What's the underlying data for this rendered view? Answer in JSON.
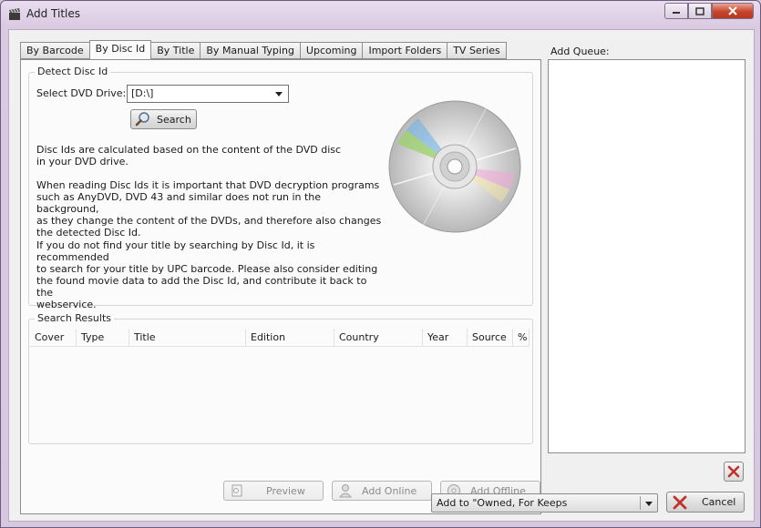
{
  "window": {
    "title": "Add Titles"
  },
  "tabs": [
    {
      "label": "By Barcode"
    },
    {
      "label": "By Disc Id"
    },
    {
      "label": "By Title"
    },
    {
      "label": "By Manual Typing"
    },
    {
      "label": "Upcoming"
    },
    {
      "label": "Import Folders"
    },
    {
      "label": "TV Series"
    }
  ],
  "detect": {
    "group_label": "Detect Disc Id",
    "drive_label": "Select DVD Drive:",
    "drive_value": "[D:\\]",
    "search_label": "Search",
    "para1": "Disc Ids are calculated based on the content of the DVD disc\nin your DVD drive.",
    "para2": "When reading Disc Ids it is important that DVD decryption programs\nsuch as AnyDVD, DVD 43 and similar does not run in the background,\nas they change the content of the DVDs, and therefore also changes\nthe detected Disc Id.",
    "para3": "If you do not find your title by searching by Disc Id, it is recommended\nto search for your title by UPC barcode. Please also consider editing\nthe found movie data to add the Disc Id, and contribute it back to the\nwebservice."
  },
  "results": {
    "group_label": "Search Results",
    "columns": [
      "Cover",
      "Type",
      "Title",
      "Edition",
      "Country",
      "Year",
      "Source",
      "%"
    ]
  },
  "actions": {
    "preview": "Preview",
    "add_online": "Add Online",
    "add_offline": "Add Offline"
  },
  "queue": {
    "label": "Add Queue:"
  },
  "footer": {
    "add_to": "Add to \"Owned, For Keeps",
    "cancel": "Cancel"
  },
  "colors": {
    "accent_red": "#c0322a",
    "window_frame": "#d7c7df"
  }
}
